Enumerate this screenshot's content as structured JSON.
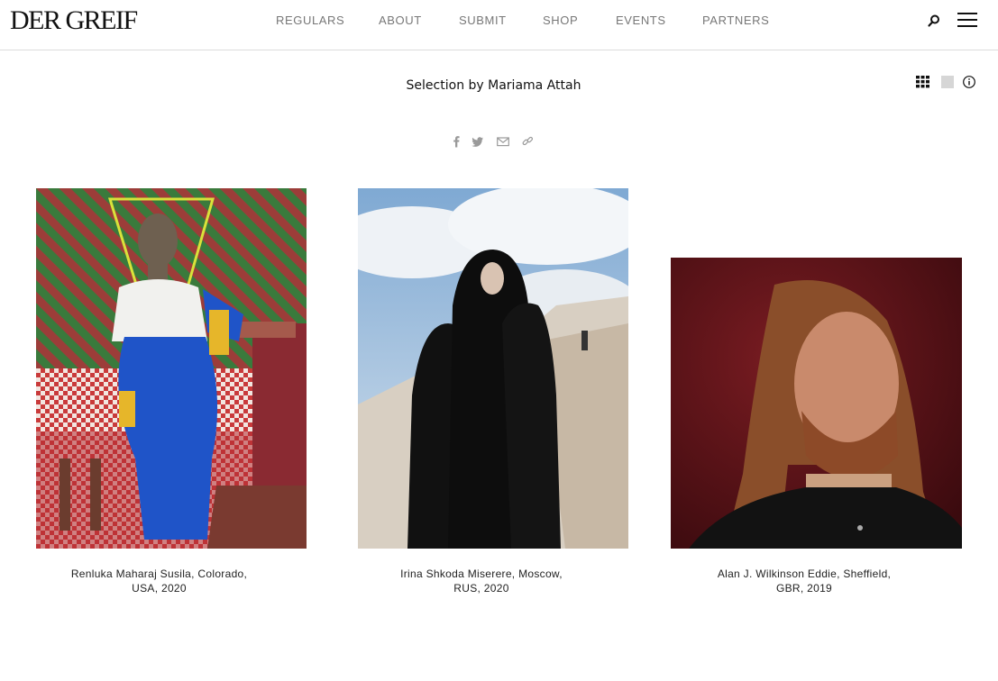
{
  "header": {
    "logo": "DER GREIF",
    "nav": [
      "REGULARS",
      "ABOUT",
      "SUBMIT",
      "SHOP",
      "EVENTS",
      "PARTNERS"
    ]
  },
  "selection": {
    "title": "Selection by Mariama Attah"
  },
  "view_controls": [
    "grid-view-icon",
    "single-view-icon",
    "info-icon"
  ],
  "share_icons": [
    "facebook-icon",
    "twitter-icon",
    "email-icon",
    "link-icon"
  ],
  "gallery": [
    {
      "caption_line1": "Renluka Maharaj Susila, Colorado,",
      "caption_line2": "USA, 2020"
    },
    {
      "caption_line1": "Irina Shkoda Miserere, Moscow,",
      "caption_line2": "RUS, 2020"
    },
    {
      "caption_line1": "Alan J. Wilkinson Eddie, Sheffield,",
      "caption_line2": "GBR, 2019"
    }
  ],
  "colors": {
    "text": "#111111",
    "nav": "#777777",
    "divider": "#dcdcdc",
    "icon": "#999999"
  }
}
